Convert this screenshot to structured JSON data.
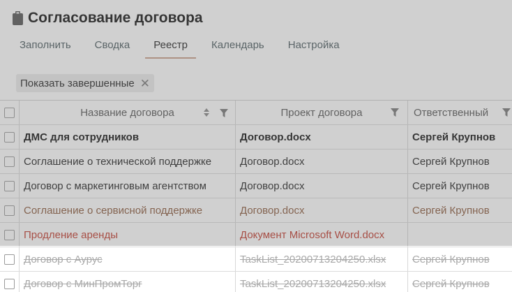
{
  "header": {
    "title": "Согласование договора",
    "icon": "clipboard-icon"
  },
  "tabs": [
    {
      "label": "Заполнить"
    },
    {
      "label": "Сводка"
    },
    {
      "label": "Реестр",
      "active": true
    },
    {
      "label": "Календарь"
    },
    {
      "label": "Настройка"
    }
  ],
  "filter_chip": {
    "label": "Показать завершенные",
    "close": "✕"
  },
  "table": {
    "columns": [
      "Название договора",
      "Проект договора",
      "Ответственный"
    ],
    "rows": [
      {
        "name": "ДМС для сотрудников",
        "project": "Договор.docx",
        "owner": "Сергей Крупнов",
        "style": "bold"
      },
      {
        "name": "Соглашение о технической поддержке",
        "project": "Договор.docx",
        "owner": "Сергей Крупнов",
        "style": "normal"
      },
      {
        "name": "Договор с маркетинговым агентством",
        "project": "Договор.docx",
        "owner": "Сергей Крупнов",
        "style": "normal"
      },
      {
        "name": "Соглашение о сервисной поддержке",
        "project": "Договор.docx",
        "owner": "Сергей Крупнов",
        "style": "brown"
      },
      {
        "name": "Продление аренды",
        "project": "Документ Microsoft Word.docx",
        "owner": "",
        "style": "red"
      },
      {
        "name": "Договор с Аурус",
        "project": "TaskList_20200713204250.xlsx",
        "owner": "Сергей Крупнов",
        "style": "done"
      },
      {
        "name": "Договор с МинПромТорг",
        "project": "TaskList_20200713204250.xlsx",
        "owner": "Сергей Крупнов",
        "style": "done"
      }
    ]
  },
  "colors": {
    "accent": "#c9a08a",
    "brown": "#8b5a3c",
    "red": "#c0392b",
    "muted": "#a8a8a8"
  }
}
